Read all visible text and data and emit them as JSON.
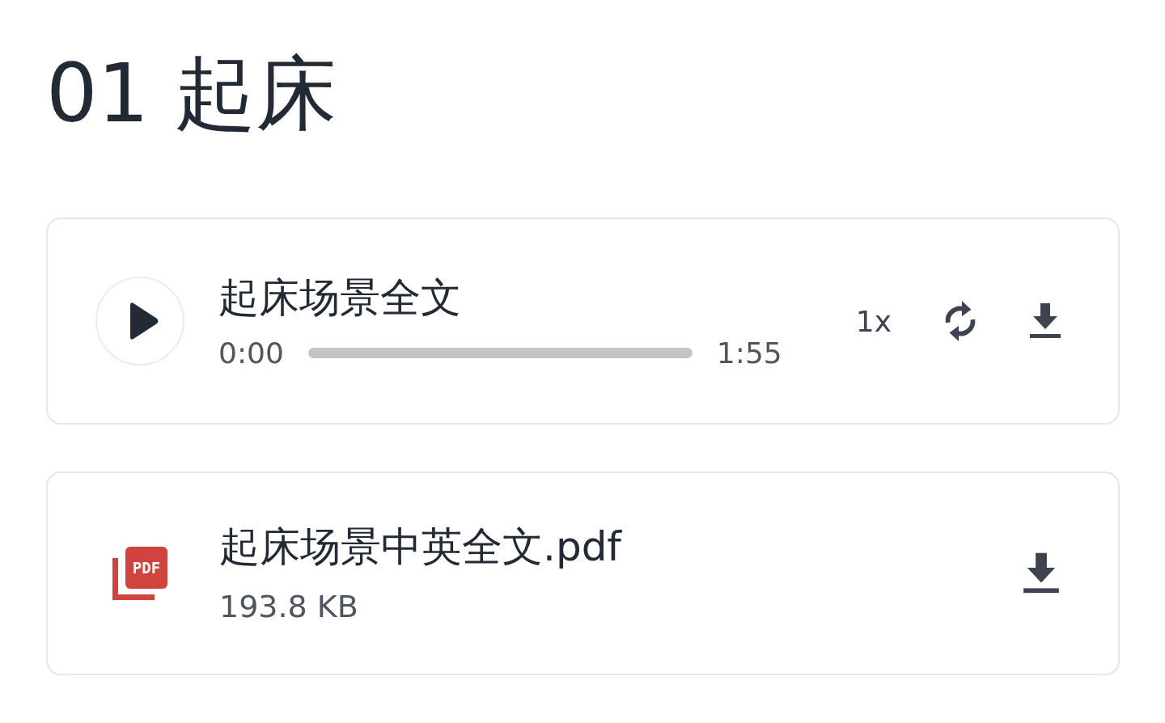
{
  "title": "01 起床",
  "audio": {
    "name": "起床场景全文",
    "playing": false,
    "current_time": "0:00",
    "duration": "1:55",
    "level": 0,
    "speed": "1x"
  },
  "file": {
    "icon_label": "PDF",
    "name": "起床场景中英全文.pdf",
    "size": "193.8 KB"
  }
}
